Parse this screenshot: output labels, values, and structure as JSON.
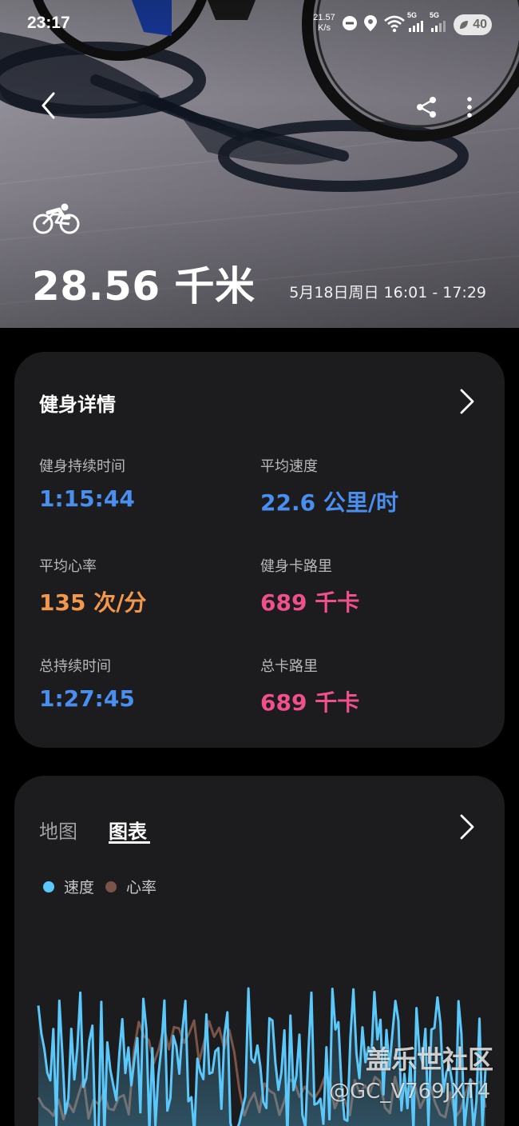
{
  "status_bar": {
    "time": "23:17",
    "net_speed_value": "21.57",
    "net_speed_unit": "K/s",
    "signal1_label": "5G",
    "signal2_label": "5G",
    "battery": "40"
  },
  "hero": {
    "distance": "28.56 千米",
    "session_time": "5月18日周日 16:01 - 17:29"
  },
  "details": {
    "title": "健身详情",
    "stats": [
      {
        "label": "健身持续时间",
        "value": "1:15:44",
        "color": "#4a8ff0"
      },
      {
        "label": "平均速度",
        "value": "22.6 公里/时",
        "color": "#4a8ff0"
      },
      {
        "label": "平均心率",
        "value": "135 次/分",
        "color": "#f2984c"
      },
      {
        "label": "健身卡路里",
        "value": "689 千卡",
        "color": "#f0508c"
      },
      {
        "label": "总持续时间",
        "value": "1:27:45",
        "color": "#4a8ff0"
      },
      {
        "label": "总卡路里",
        "value": "689 千卡",
        "color": "#f0508c"
      }
    ]
  },
  "chart_panel": {
    "tabs": [
      "地图",
      "图表"
    ],
    "selected_tab": "图表",
    "legend": [
      {
        "name": "速度",
        "color": "#5ac8fa"
      },
      {
        "name": "心率",
        "color": "#7a5446"
      }
    ]
  },
  "watermark": {
    "line1": "盖乐世社区",
    "line2": "@GC_V769JXT4"
  }
}
